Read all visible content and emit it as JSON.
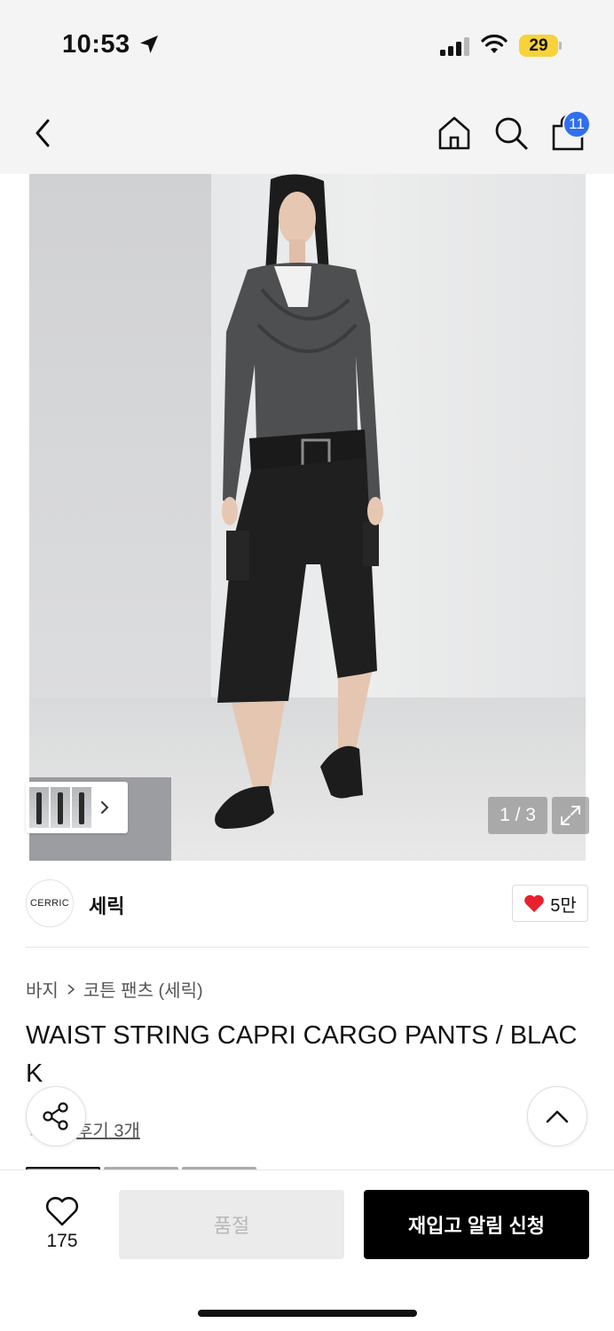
{
  "status_bar": {
    "time": "10:53",
    "battery_level": "29",
    "icons": [
      "location-arrow-icon",
      "cellular-signal-icon",
      "wifi-icon",
      "battery-icon"
    ]
  },
  "nav": {
    "icons": [
      "back-icon",
      "home-icon",
      "search-icon",
      "cart-icon"
    ],
    "cart_badge": "11",
    "badge_color": "#2f6ff0"
  },
  "gallery": {
    "page_counter": "1 / 3",
    "thumbnail_count": 3
  },
  "brand": {
    "logo_text": "CERRIC",
    "name": "세릭",
    "likes": "5만",
    "like_color": "#e8212f"
  },
  "product": {
    "breadcrumb": [
      "바지",
      "코튼 팬츠 (세릭)"
    ],
    "title": "WAIST STRING CAPRI CARGO PANTS / BLACK",
    "review_link": "후기 3개"
  },
  "bottom_bar": {
    "wish_count": "175",
    "soldout_label": "품절",
    "restock_label": "재입고 알림 신청"
  }
}
